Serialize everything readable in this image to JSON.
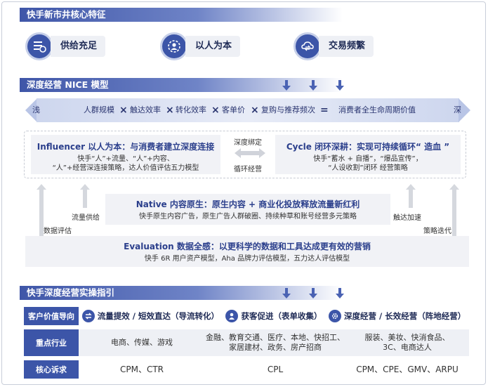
{
  "sections": {
    "s1": "快手新市井核心特征",
    "s2": "深度经营 NICE 模型",
    "s3": "快手深度经营实操指引"
  },
  "features": [
    {
      "label": "供给充足",
      "icon": "list-tap-icon"
    },
    {
      "label": "以人为本",
      "icon": "person-gear-icon"
    },
    {
      "label": "交易频繁",
      "icon": "cloud-exchange-icon"
    }
  ],
  "nice_bar": {
    "left": "浅",
    "right": "深",
    "terms": [
      "人群规模",
      "触达效率",
      "转化效率",
      "客单价",
      "复购与推荐频次",
      "消费者全生命周期价值"
    ],
    "times": "×",
    "equals": "="
  },
  "influencer": {
    "title": "Influencer 以人为本：与消费者建立深度连接",
    "line1": "快手“人”+流量、“人”+内容、",
    "line2": "“人”+经营深连接策略，达人价值评估五力模型"
  },
  "cycle": {
    "title": "Cycle 闭环深耕：实现可持续循环“ 造血 ”",
    "line1": "快手“蓄水 + 自播”，“爆品宣传”，",
    "line2": "“人设收割”闭环 经营策略"
  },
  "middle": {
    "top": "深度绑定",
    "bottom": "循环经营"
  },
  "native": {
    "title": "Native 内容原生：原生内容 + 商业化投放释放流量新红利",
    "line": "快手原生内容广告，原生广告人群破圈、持续种草和账号经营多元策略"
  },
  "evaluation": {
    "title": "Evaluation 数据全感：以更科学的数据和工具达成更有效的营销",
    "line": "快手 6R 用户资产模型，Aha 品牌力评估模型，五力达人评估模型"
  },
  "side_labels": {
    "flow_supply": "流量供给",
    "data_eval": "数据评估",
    "reach_speed": "触达加速",
    "strategy_iter": "策略迭代"
  },
  "table": {
    "rows": [
      {
        "head": "客户价值导向",
        "cells": [
          {
            "text": "流量提效 / 短效直达（导流转化）",
            "icon": "exchange-icon"
          },
          {
            "text": "获客促进（表单收集）",
            "icon": "user-icon"
          },
          {
            "text": "深度经营 / 长效经营（阵地经营）",
            "icon": "gear-icon"
          }
        ]
      },
      {
        "head": "重点行业",
        "cells": [
          {
            "line1": "电商、传媒、游戏",
            "line2": ""
          },
          {
            "line1": "金融、教育交通、医疗、本地、快招工、",
            "line2": "家居建材、政务、房产招商"
          },
          {
            "line1": "服装、美妆、快消食品、",
            "line2": "3C、电商达人"
          }
        ]
      },
      {
        "head": "核心诉求",
        "cells": [
          {
            "line1": "CPM、CTR"
          },
          {
            "line1": "CPL"
          },
          {
            "line1": "CPM、CPE、GMV、ARPU"
          }
        ]
      }
    ]
  },
  "colors": {
    "primary": "#3c55a8",
    "panel": "#f1f2f6",
    "accent_text": "#2b3f8c"
  }
}
